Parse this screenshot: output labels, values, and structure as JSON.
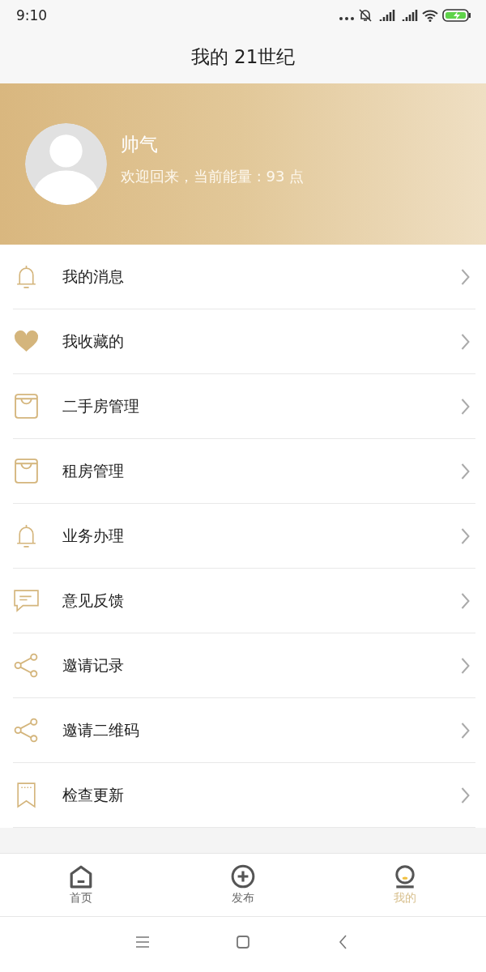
{
  "status_bar": {
    "time": "9:10"
  },
  "title_bar": {
    "title": "我的 21世纪"
  },
  "profile": {
    "name": "帅气",
    "subtitle": "欢迎回来，当前能量 : 93 点"
  },
  "menu": [
    {
      "kind": "bell",
      "label": "我的消息"
    },
    {
      "kind": "heart",
      "label": "我收藏的"
    },
    {
      "kind": "bag",
      "label": "二手房管理"
    },
    {
      "kind": "bag",
      "label": "租房管理"
    },
    {
      "kind": "bell",
      "label": "业务办理"
    },
    {
      "kind": "chat",
      "label": "意见反馈"
    },
    {
      "kind": "share",
      "label": "邀请记录"
    },
    {
      "kind": "share",
      "label": "邀请二维码"
    },
    {
      "kind": "bookmark",
      "label": "检查更新"
    }
  ],
  "tab_bar": [
    {
      "kind": "home",
      "label": "首页",
      "selected": false
    },
    {
      "kind": "plus",
      "label": "发布",
      "selected": false
    },
    {
      "kind": "person",
      "label": "我的",
      "selected": true
    }
  ]
}
